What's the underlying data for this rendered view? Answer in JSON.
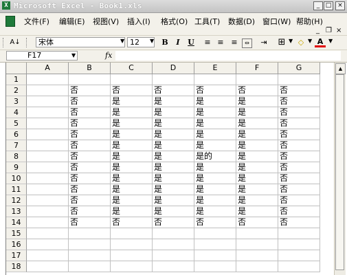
{
  "window": {
    "title": "Microsoft Excel - Book1.xls",
    "buttons": {
      "minimize": "_",
      "maximize": "□",
      "close": "×"
    },
    "doc_controls": {
      "minimize": "_",
      "restore": "❐",
      "close": "×"
    }
  },
  "menu": [
    {
      "label": "文件(F)"
    },
    {
      "label": "编辑(E)"
    },
    {
      "label": "视图(V)"
    },
    {
      "label": "插入(I)"
    },
    {
      "label": "格式(O)"
    },
    {
      "label": "工具(T)"
    },
    {
      "label": "数据(D)"
    },
    {
      "label": "窗口(W)"
    },
    {
      "label": "帮助(H)"
    }
  ],
  "toolbar": {
    "font_name": "宋体",
    "font_size": "12",
    "bold": "B",
    "italic": "I",
    "underline": "U",
    "sort_icon": "A↓",
    "font_color": "A"
  },
  "formula_bar": {
    "cell_ref": "F17",
    "fx": "fx",
    "value": ""
  },
  "sheet": {
    "columns": [
      "A",
      "B",
      "C",
      "D",
      "E",
      "F",
      "G"
    ],
    "rows": [
      {
        "n": "1",
        "cells": [
          "",
          "",
          "",
          "",
          "",
          "",
          ""
        ]
      },
      {
        "n": "2",
        "cells": [
          "",
          "否",
          "否",
          "否",
          "否",
          "否",
          "否"
        ]
      },
      {
        "n": "3",
        "cells": [
          "",
          "否",
          "是",
          "是",
          "是",
          "是",
          "否"
        ]
      },
      {
        "n": "4",
        "cells": [
          "",
          "否",
          "是",
          "是",
          "是",
          "是",
          "否"
        ]
      },
      {
        "n": "5",
        "cells": [
          "",
          "否",
          "是",
          "是",
          "是",
          "是",
          "否"
        ]
      },
      {
        "n": "6",
        "cells": [
          "",
          "否",
          "是",
          "是",
          "是",
          "是",
          "否"
        ]
      },
      {
        "n": "7",
        "cells": [
          "",
          "否",
          "是",
          "是",
          "是",
          "是",
          "否"
        ]
      },
      {
        "n": "8",
        "cells": [
          "",
          "否",
          "是",
          "是",
          "是的",
          "是",
          "否"
        ]
      },
      {
        "n": "9",
        "cells": [
          "",
          "否",
          "是",
          "是",
          "是",
          "是",
          "否"
        ]
      },
      {
        "n": "10",
        "cells": [
          "",
          "否",
          "是",
          "是",
          "是",
          "是",
          "否"
        ]
      },
      {
        "n": "11",
        "cells": [
          "",
          "否",
          "是",
          "是",
          "是",
          "是",
          "否"
        ]
      },
      {
        "n": "12",
        "cells": [
          "",
          "否",
          "是",
          "是",
          "是",
          "是",
          "否"
        ]
      },
      {
        "n": "13",
        "cells": [
          "",
          "否",
          "是",
          "是",
          "是",
          "是",
          "否"
        ]
      },
      {
        "n": "14",
        "cells": [
          "",
          "否",
          "否",
          "否",
          "否",
          "否",
          "否"
        ]
      },
      {
        "n": "15",
        "cells": [
          "",
          "",
          "",
          "",
          "",
          "",
          ""
        ]
      },
      {
        "n": "16",
        "cells": [
          "",
          "",
          "",
          "",
          "",
          "",
          ""
        ]
      },
      {
        "n": "17",
        "cells": [
          "",
          "",
          "",
          "",
          "",
          "",
          ""
        ]
      },
      {
        "n": "18",
        "cells": [
          "",
          "",
          "",
          "",
          "",
          "",
          ""
        ]
      }
    ]
  }
}
